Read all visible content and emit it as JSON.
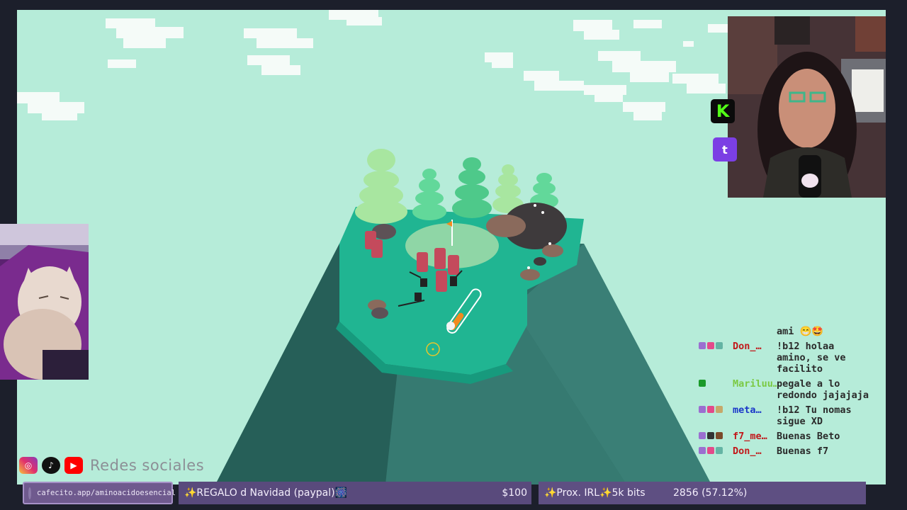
{
  "game": {
    "colors": {
      "sky": "#b6ecd9",
      "grass": "#20b592",
      "cliff": "#2f6f67",
      "green": "#8fd6a6",
      "tree": "#78dfa0",
      "barrel": "#c44a5c"
    }
  },
  "overlay": {
    "kick_glyph": "K",
    "twitch_glyph": "t"
  },
  "chat": [
    {
      "user": "",
      "user_color": "#222222",
      "message": "ami 😁🤩",
      "badges": []
    },
    {
      "user": "Don_…",
      "user_color": "#c2181a",
      "message": "!b12 holaa amino, se ve facilito",
      "badges": [
        "#9b6fd0",
        "#e34a8a",
        "#64b4a4"
      ]
    },
    {
      "user": "Mariluu…",
      "user_color": "#7ac943",
      "message": "pegale a lo redondo jajajaja",
      "badges": [
        "#1a9a2a"
      ]
    },
    {
      "user": "meta…",
      "user_color": "#1a37c9",
      "message": "!b12 Tu nomas sigue XD",
      "badges": [
        "#9b6fd0",
        "#e34a8a",
        "#c6a86a"
      ]
    },
    {
      "user": "f7_me…",
      "user_color": "#c2181a",
      "message": "Buenas Beto",
      "badges": [
        "#9b6fd0",
        "#333333",
        "#7a4a2a"
      ]
    },
    {
      "user": "Don_…",
      "user_color": "#c2181a",
      "message": "Buenas f7",
      "badges": [
        "#9b6fd0",
        "#e34a8a",
        "#64b4a4"
      ]
    }
  ],
  "socials": {
    "label": "Redes sociales",
    "icons": [
      "instagram-icon",
      "tiktok-icon",
      "youtube-icon"
    ]
  },
  "bottom_bar": {
    "cafecito_url": "cafecito.app/aminoacidoesencial",
    "goal1_label": "✨REGALO d Navidad (paypal)🎆",
    "goal1_amount": "$100",
    "goal2_label": "✨Prox. IRL✨5k bits",
    "goal2_progress": "2856 (57.12%)",
    "goal2_fraction": 0.5712
  }
}
